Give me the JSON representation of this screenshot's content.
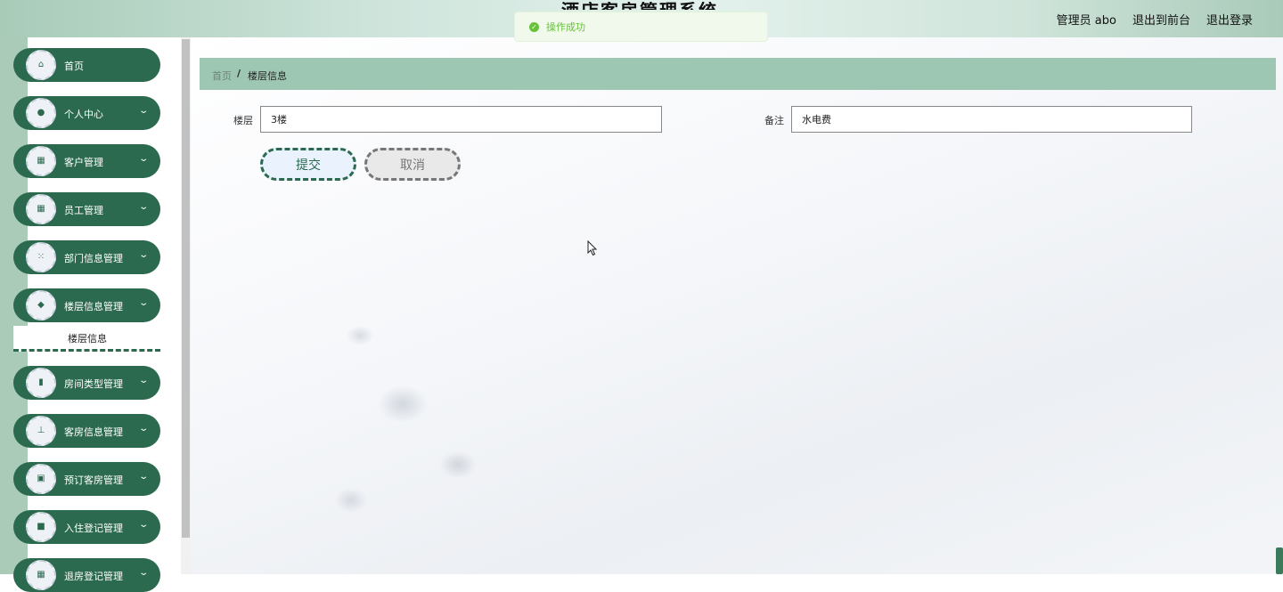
{
  "header": {
    "system_title": "酒店客房管理系统",
    "user_label": "管理员 abo",
    "to_frontend": "退出到前台",
    "logout": "退出登录"
  },
  "toast": {
    "message": "操作成功",
    "icon": "check-circle-icon",
    "color": "#67c23a"
  },
  "sidebar": {
    "items": [
      {
        "label": "首页",
        "icon": "home-icon",
        "expandable": false
      },
      {
        "label": "个人中心",
        "icon": "user-icon",
        "expandable": true
      },
      {
        "label": "客户管理",
        "icon": "grid-icon",
        "expandable": true
      },
      {
        "label": "员工管理",
        "icon": "grid-icon",
        "expandable": true
      },
      {
        "label": "部门信息管理",
        "icon": "apps-icon",
        "expandable": true
      },
      {
        "label": "楼层信息管理",
        "icon": "location-icon",
        "expandable": true
      },
      {
        "label": "房间类型管理",
        "icon": "bar-chart-icon",
        "expandable": true
      },
      {
        "label": "客房信息管理",
        "icon": "stamp-icon",
        "expandable": true
      },
      {
        "label": "预订客房管理",
        "icon": "trend-icon",
        "expandable": true
      },
      {
        "label": "入住登记管理",
        "icon": "briefcase-icon",
        "expandable": true
      },
      {
        "label": "退房登记管理",
        "icon": "grid-icon",
        "expandable": true
      }
    ],
    "submenu_active": "楼层信息"
  },
  "breadcrumb": {
    "home": "首页",
    "separator": "/",
    "current": "楼层信息"
  },
  "form": {
    "floor_label": "楼层",
    "floor_value": "3楼",
    "remark_label": "备注",
    "remark_value": "水电费",
    "submit_label": "提交",
    "cancel_label": "取消"
  },
  "colors": {
    "primary": "#2c6a4f",
    "breadcrumb_bg": "#9dc7b3",
    "header_accent": "#a9cbb8"
  }
}
